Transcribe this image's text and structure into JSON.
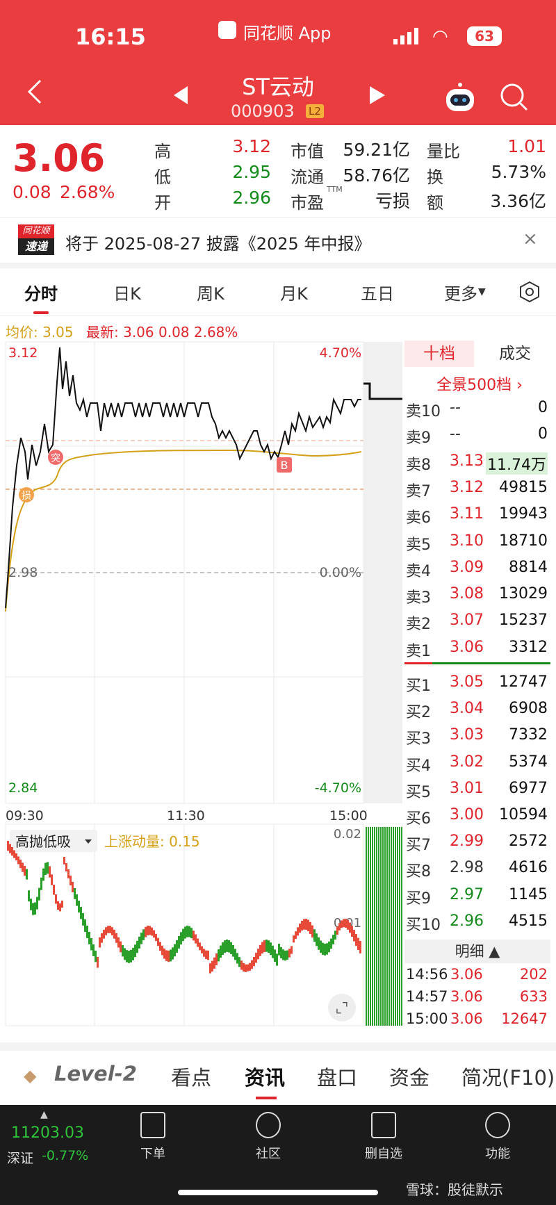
{
  "status_bar": {
    "time": "16:15",
    "app": "同花顺 App",
    "battery": "63"
  },
  "header": {
    "title": "ST云动",
    "code": "000903",
    "level_badge": "L2"
  },
  "quote": {
    "price": "3.06",
    "change": "0.08",
    "change_pct": "2.68%",
    "high_label": "高",
    "high": "3.12",
    "low_label": "低",
    "low": "2.95",
    "open_label": "开",
    "open": "2.96",
    "mktcap_label": "市值",
    "mktcap": "59.21亿",
    "float_label": "流通",
    "float": "58.76亿",
    "pe_label": "市盈",
    "pe_sup": "TTM",
    "pe": "亏损",
    "vr_label": "量比",
    "vr": "1.01",
    "turn_label": "换",
    "turn": "5.73%",
    "amt_label": "额",
    "amt": "3.36亿"
  },
  "notice": {
    "logo_top": "同花顺",
    "logo_bottom": "速递",
    "text": "将于 2025-08-27 披露《2025 年中报》"
  },
  "tabs": [
    "分时",
    "日K",
    "周K",
    "月K",
    "五日",
    "更多"
  ],
  "chart_info": {
    "avg": "均价: 3.05",
    "latest": "最新: 3.06  0.08  2.68%"
  },
  "chart_axis": {
    "ytop": "3.12",
    "ytop_pct": "4.70%",
    "ymid": "2.98",
    "ymid_pct": "0.00%",
    "ybot": "2.84",
    "ybot_pct": "-4.70%",
    "t1": "09:30",
    "t2": "11:30",
    "t3": "15:00"
  },
  "markers": {
    "tu": "突",
    "sun": "损",
    "b": "B"
  },
  "indicator": {
    "name": "高抛低吸",
    "label": "上涨动量: 0.15",
    "tick1": "0.02",
    "tick2": "0.01"
  },
  "order_book": {
    "tab1": "十档",
    "tab2": "成交",
    "panorama": "全景500档 ›",
    "asks": [
      {
        "label": "卖10",
        "price": "--",
        "vol": "0"
      },
      {
        "label": "卖9",
        "price": "--",
        "vol": "0"
      },
      {
        "label": "卖8",
        "price": "3.13",
        "vol": "11.74万"
      },
      {
        "label": "卖7",
        "price": "3.12",
        "vol": "49815"
      },
      {
        "label": "卖6",
        "price": "3.11",
        "vol": "19943"
      },
      {
        "label": "卖5",
        "price": "3.10",
        "vol": "18710"
      },
      {
        "label": "卖4",
        "price": "3.09",
        "vol": "8814"
      },
      {
        "label": "卖3",
        "price": "3.08",
        "vol": "13029"
      },
      {
        "label": "卖2",
        "price": "3.07",
        "vol": "15237"
      },
      {
        "label": "卖1",
        "price": "3.06",
        "vol": "3312"
      }
    ],
    "bids": [
      {
        "label": "买1",
        "price": "3.05",
        "vol": "12747"
      },
      {
        "label": "买2",
        "price": "3.04",
        "vol": "6908"
      },
      {
        "label": "买3",
        "price": "3.03",
        "vol": "7332"
      },
      {
        "label": "买4",
        "price": "3.02",
        "vol": "5374"
      },
      {
        "label": "买5",
        "price": "3.01",
        "vol": "6977"
      },
      {
        "label": "买6",
        "price": "3.00",
        "vol": "10594"
      },
      {
        "label": "买7",
        "price": "2.99",
        "vol": "2572"
      },
      {
        "label": "买8",
        "price": "2.98",
        "vol": "4616"
      },
      {
        "label": "买9",
        "price": "2.97",
        "vol": "1145"
      },
      {
        "label": "买10",
        "price": "2.96",
        "vol": "4515"
      }
    ],
    "detail_title": "明细 ▲",
    "trades": [
      {
        "time": "14:56",
        "price": "3.06",
        "vol": "202"
      },
      {
        "time": "14:57",
        "price": "3.06",
        "vol": "633"
      },
      {
        "time": "15:00",
        "price": "3.06",
        "vol": "12647"
      }
    ]
  },
  "bottom_tabs": {
    "level2": "Level-2",
    "t1": "看点",
    "t2": "资讯",
    "t3": "盘口",
    "t4": "资金",
    "t5": "简况(F10)"
  },
  "nav": {
    "index_value": "11203.03",
    "index_name": "深证",
    "index_change": "-0.77%",
    "n1": "下单",
    "n2": "社区",
    "n3": "删自选",
    "n4": "功能"
  },
  "watermark": "雪球：股徒默示",
  "colors": {
    "header_red": "#e93d3f",
    "up_red": "#e0242b",
    "down_green": "#138a1a",
    "avg_gold": "#d4a017"
  }
}
